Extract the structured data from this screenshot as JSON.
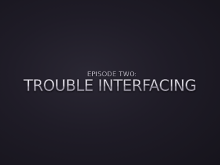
{
  "episode_label": "EPISODE TWO:",
  "episode_title": "TROUBLE INTERFACING",
  "colors": {
    "background": "#1f1c27",
    "text": "#cfccd6"
  }
}
